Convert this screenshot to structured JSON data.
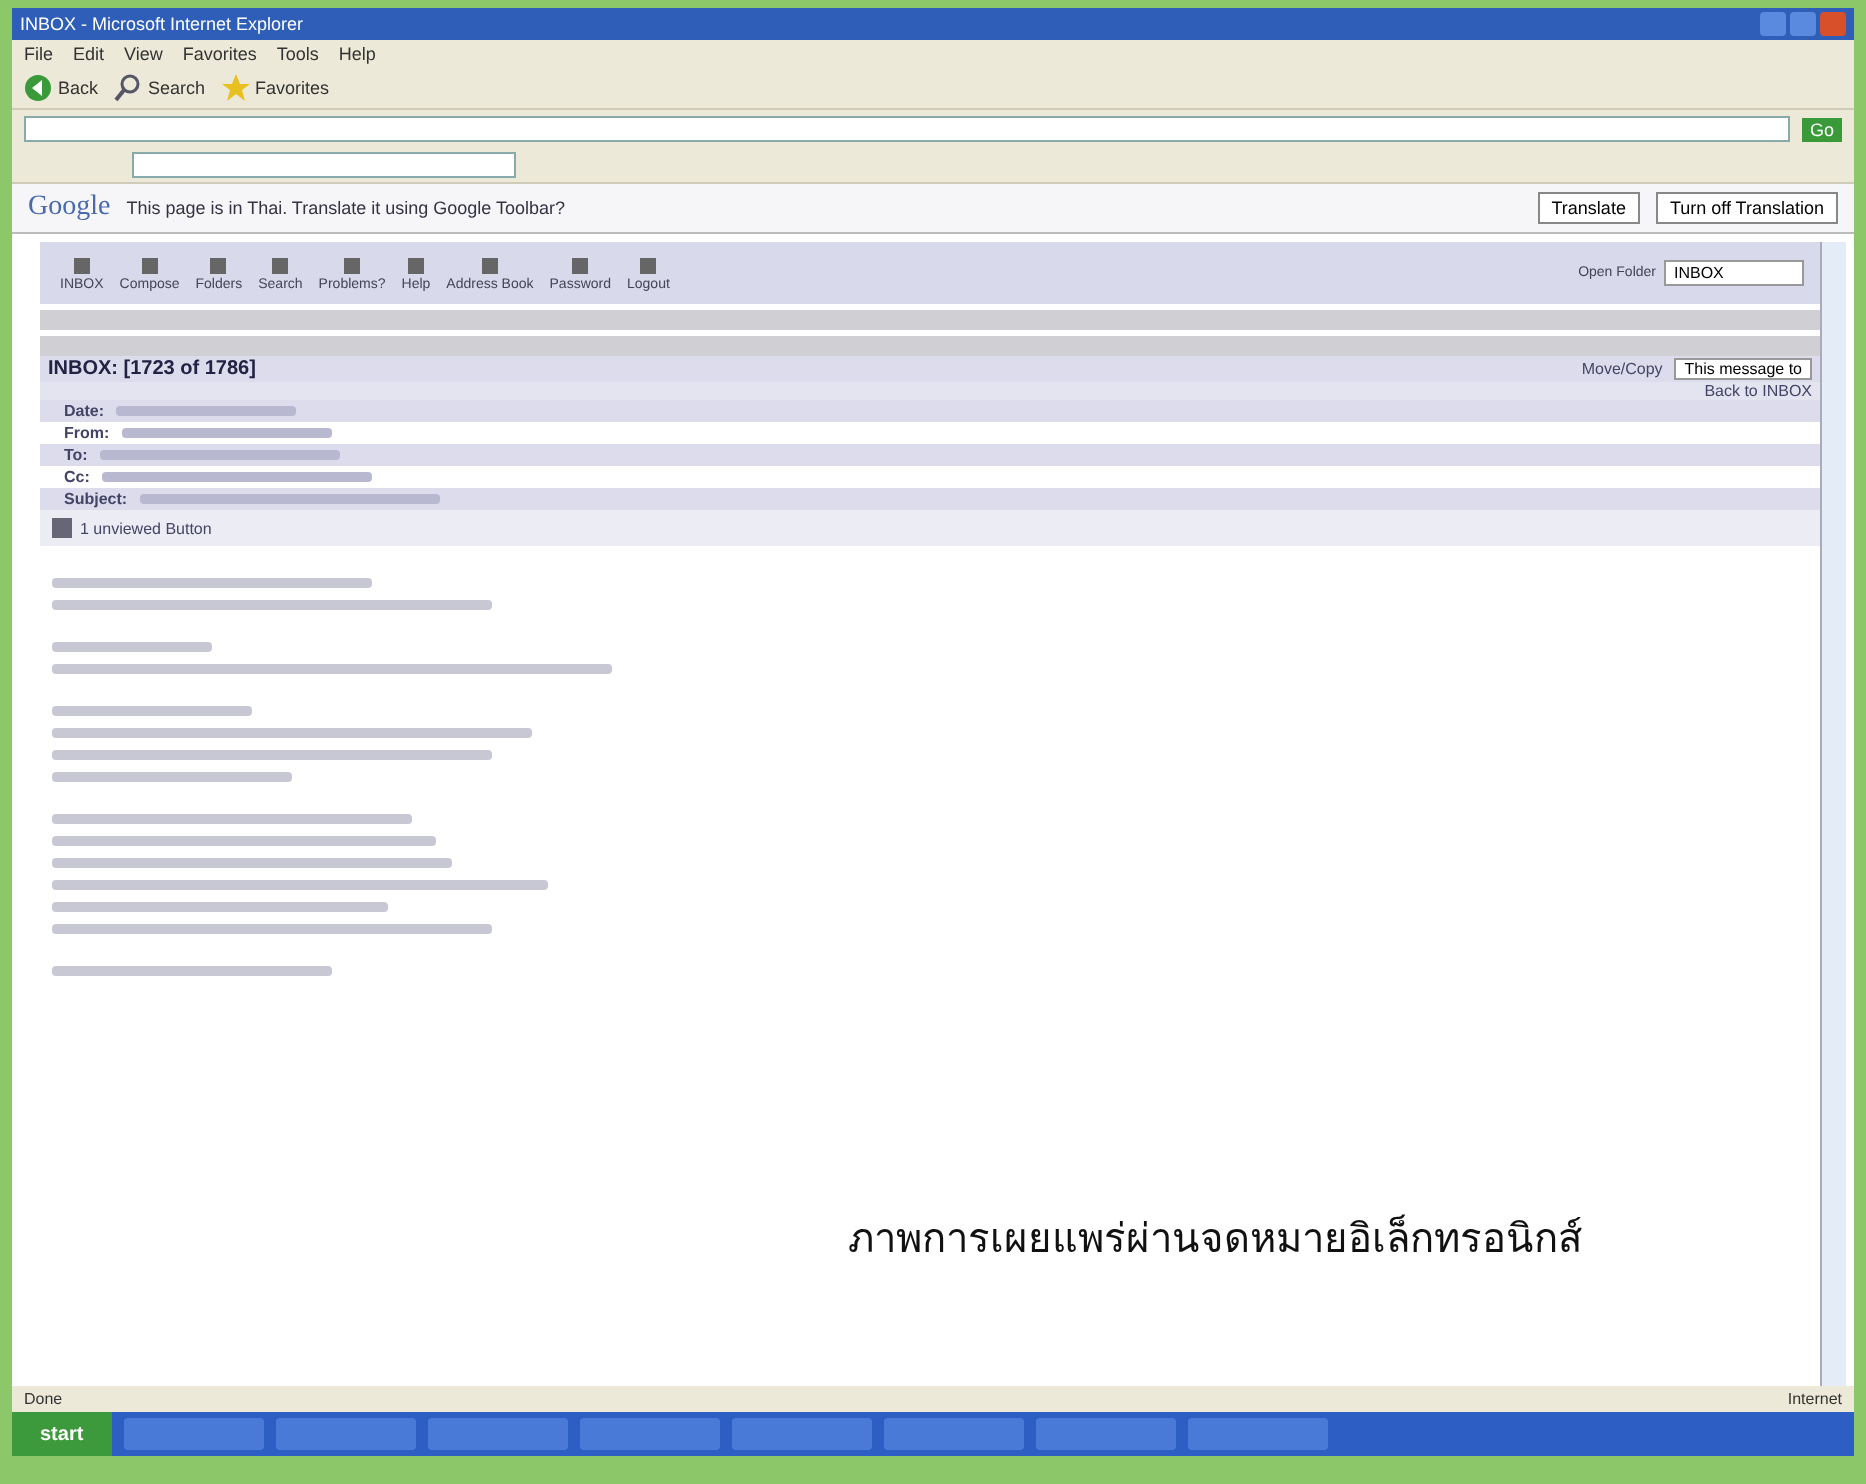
{
  "window": {
    "title": "INBOX - Microsoft Internet Explorer"
  },
  "menu": [
    "File",
    "Edit",
    "View",
    "Favorites",
    "Tools",
    "Help"
  ],
  "toolbar": [
    {
      "kind": "back",
      "label": "Back"
    },
    {
      "kind": "search",
      "label": "Search"
    },
    {
      "kind": "star",
      "label": "Favorites"
    }
  ],
  "address": {
    "go": "Go"
  },
  "google_bar": {
    "logo": "Google",
    "prompt": "This page is in Thai. Translate it using Google Toolbar?",
    "buttons": [
      "Translate",
      "Turn off Translation"
    ]
  },
  "mail_toolbar": [
    "INBOX",
    "Compose",
    "Folders",
    "Search",
    "Problems?",
    "Help",
    "Address Book",
    "Password",
    "Logout"
  ],
  "folder_select": {
    "label": "Open Folder",
    "value": "INBOX"
  },
  "message": {
    "heading": "INBOX:",
    "count": "[1723 of 1786]",
    "move_label": "Move/Copy",
    "move_value": "This message to",
    "back": "Back to INBOX",
    "fields": [
      {
        "label": "Date:"
      },
      {
        "label": "From:"
      },
      {
        "label": "To:"
      },
      {
        "label": "Cc:"
      },
      {
        "label": "Subject:"
      }
    ],
    "attachment": "1 unviewed Button"
  },
  "status_bar": {
    "left": "Done",
    "right": "Internet"
  },
  "taskbar": {
    "start": "start"
  },
  "caption": "ภาพการเผยแพร่ผ่านจดหมายอิเล็กทรอนิกส์"
}
